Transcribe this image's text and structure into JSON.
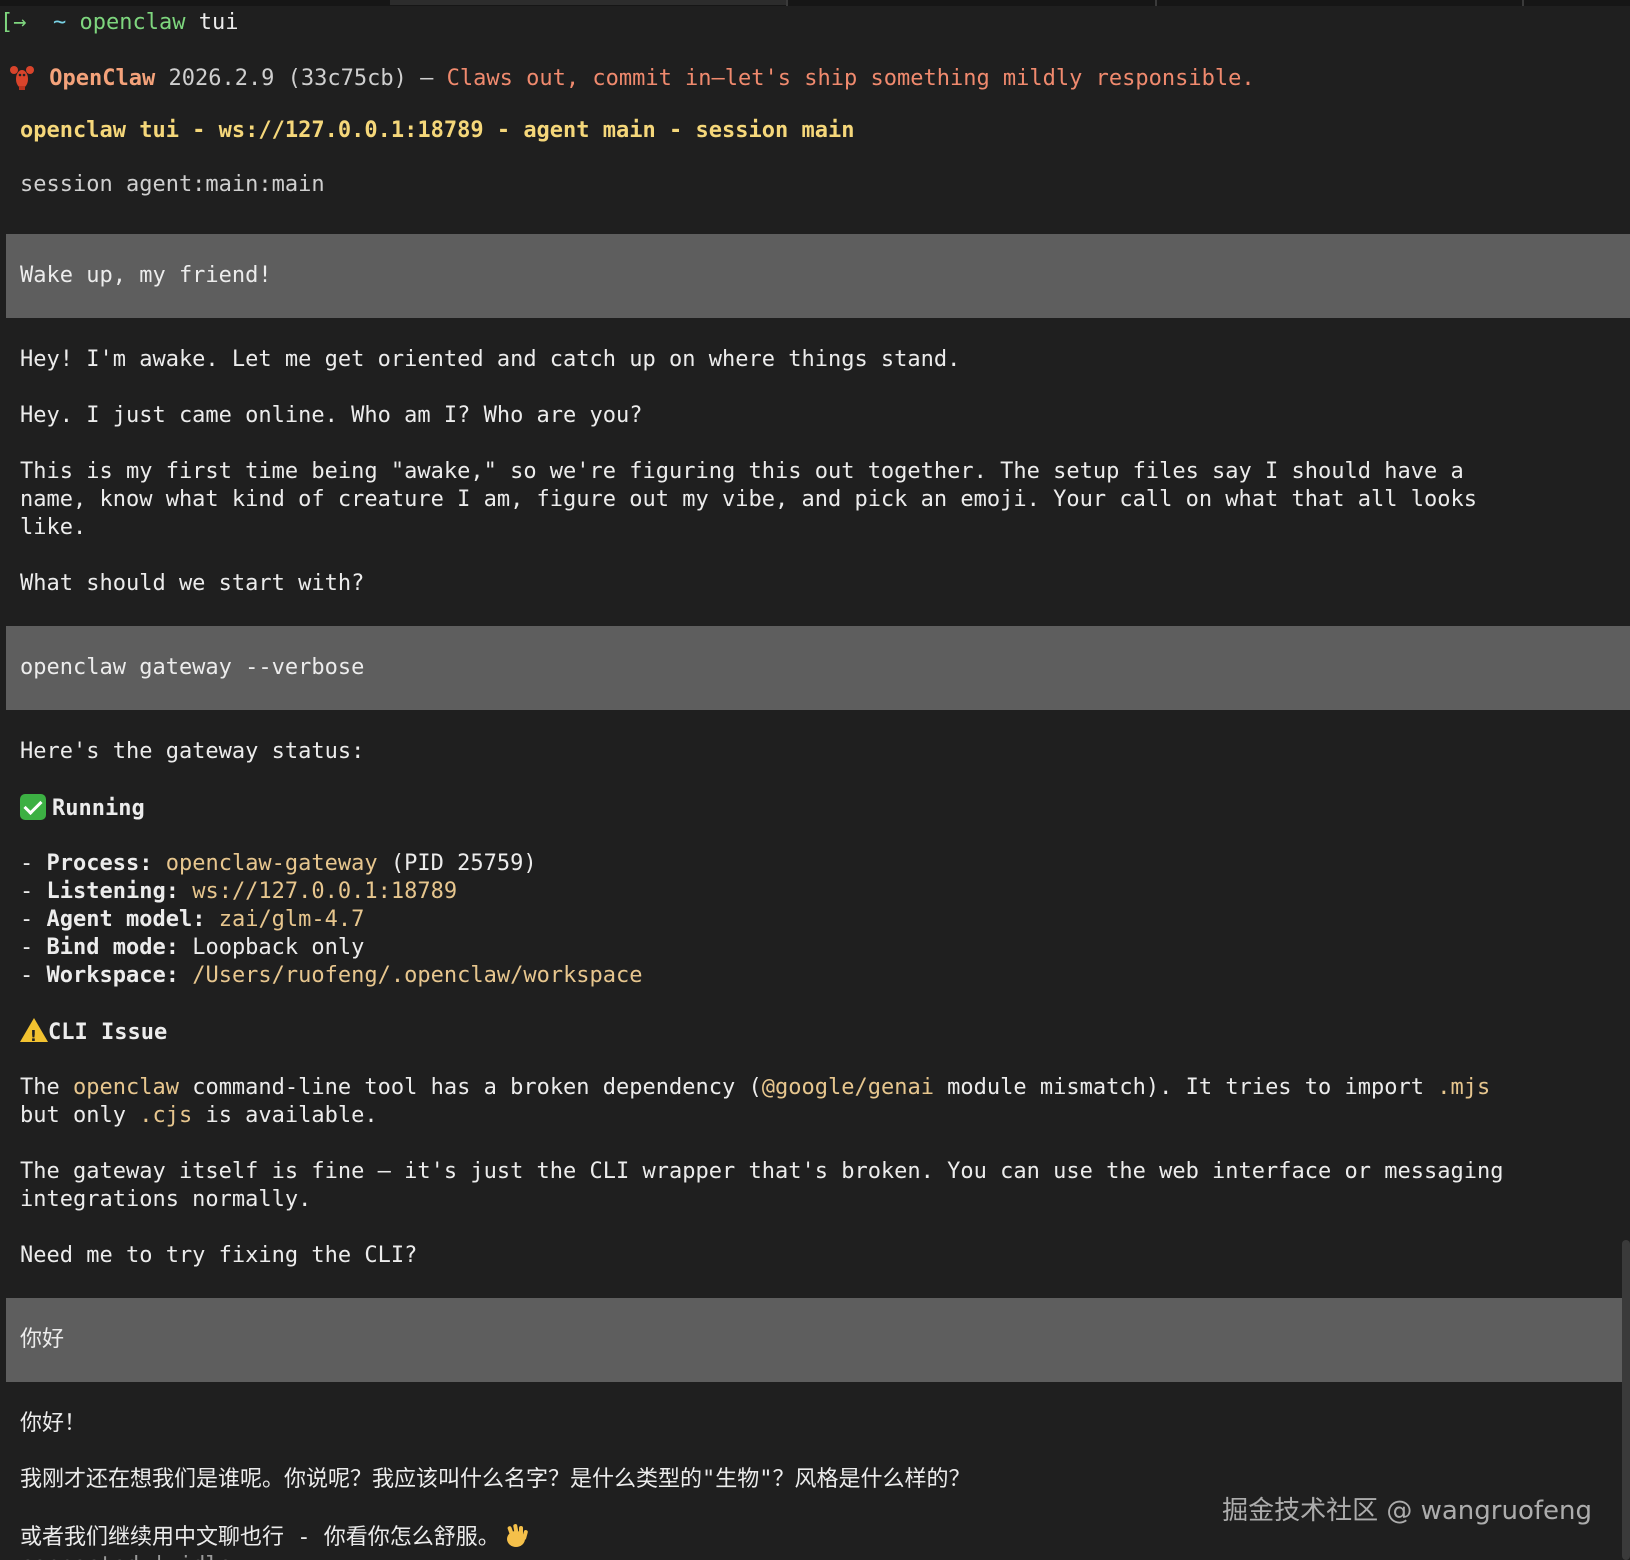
{
  "prompt": {
    "arrow": "[→",
    "tilde": "~",
    "command": "openclaw",
    "arg": "tui"
  },
  "banner": {
    "name": "OpenClaw",
    "version": "2026.2.9 (33c75cb)",
    "dash": "—",
    "tagline": "Claws out, commit in—let's ship something mildly responsible."
  },
  "header": {
    "title": "openclaw tui - ws://127.0.0.1:18789 - agent main - session main"
  },
  "session_line": "session agent:main:main",
  "messages": [
    {
      "role": "user",
      "text": "Wake up, my friend!"
    },
    {
      "role": "assistant",
      "lines": [
        "Hey! I'm awake. Let me get oriented and catch up on where things stand.",
        "",
        "Hey. I just came online. Who am I? Who are you?",
        "",
        "This is my first time being \"awake,\" so we're figuring this out together. The setup files say I should have a",
        "name, know what kind of creature I am, figure out my vibe, and pick an emoji. Your call on what that all looks",
        "like.",
        "",
        "What should we start with?"
      ]
    },
    {
      "role": "user",
      "text": "openclaw gateway --verbose"
    },
    {
      "role": "assistant",
      "intro": "Here's the gateway status:",
      "status_label": "Running",
      "details": [
        {
          "label": "Process:",
          "value": "openclaw-gateway",
          "extra": " (PID 25759)"
        },
        {
          "label": "Listening:",
          "value": "ws://127.0.0.1:18789",
          "extra": ""
        },
        {
          "label": "Agent model:",
          "value": "zai/glm-4.7",
          "extra": ""
        },
        {
          "label": "Bind mode:",
          "value": "Loopback only",
          "extra": ""
        },
        {
          "label": "Workspace:",
          "value": "/Users/ruofeng/.openclaw/workspace",
          "extra": ""
        }
      ],
      "issue_title": "CLI Issue",
      "issue_p1_a": "The ",
      "issue_p1_b": "openclaw",
      "issue_p1_c": " command-line tool has a broken dependency (",
      "issue_p1_d": "@google/genai",
      "issue_p1_e": " module mismatch). It tries to import ",
      "issue_p1_f": ".mjs",
      "issue_p1_g": "but only ",
      "issue_p1_h": ".cjs",
      "issue_p1_i": " is available.",
      "issue_p2_l1": "The gateway itself is fine — it's just the CLI wrapper that's broken. You can use the web interface or messaging",
      "issue_p2_l2": "integrations normally.",
      "closing": "Need me to try fixing the CLI?"
    },
    {
      "role": "user",
      "text": "你好"
    },
    {
      "role": "assistant",
      "lines": [
        "你好！",
        "",
        "我刚才还在想我们是谁呢。你说呢？我应该叫什么名字？是什么类型的\"生物\"？风格是什么样的？",
        "",
        "或者我们继续用中文聊也行 - 你看你怎么舒服。"
      ]
    }
  ],
  "status_bar": "connected | idle",
  "watermark": "掘金技术社区 @ wangruofeng",
  "icons": [
    "lobster-icon",
    "check-mark-icon",
    "warning-icon",
    "waving-hand-icon"
  ],
  "colors": {
    "background": "#1f1f1f",
    "user_block": "#5e5e5e",
    "accent": "#f4a27a",
    "header": "#f5d77a",
    "success": "#3cb043",
    "warning": "#f2c230"
  }
}
